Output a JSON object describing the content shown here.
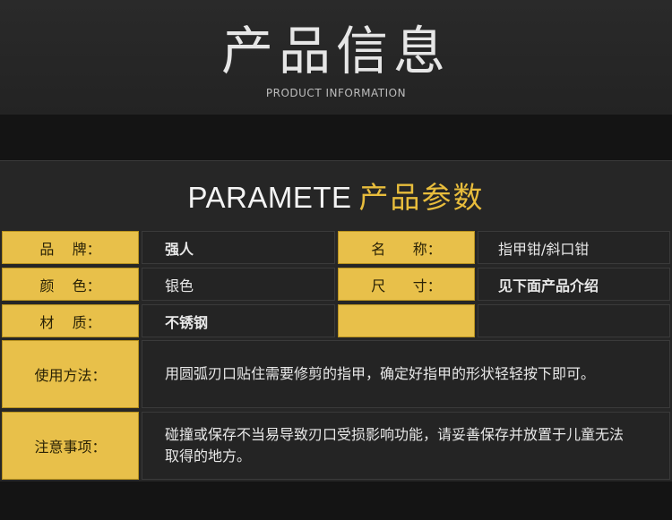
{
  "header": {
    "title": "产品信息",
    "subtitle": "PRODUCT INFORMATION"
  },
  "section": {
    "title_en": "PARAMETE",
    "title_cn": "产品参数"
  },
  "params": {
    "brand_label": "品    牌：",
    "brand_value": "强人",
    "name_label": "名      称：",
    "name_value": "指甲钳/斜口钳",
    "color_label": "颜    色：",
    "color_value": "银色",
    "size_label": "尺      寸：",
    "size_value": "见下面产品介绍",
    "material_label": "材    质：",
    "material_value": "不锈钢",
    "usage_label": "使用方法：",
    "usage_value": "用圆弧刃口贴住需要修剪的指甲，确定好指甲的形状轻轻按下即可。",
    "notice_label": "注意事项：",
    "notice_value": "碰撞或保存不当易导致刃口受损影响功能，请妥善保存并放置于儿童无法取得的地方。"
  },
  "colors": {
    "gold": "#e8c04a",
    "title_gold": "#e8bd3c",
    "dark_cell": "#242424"
  }
}
